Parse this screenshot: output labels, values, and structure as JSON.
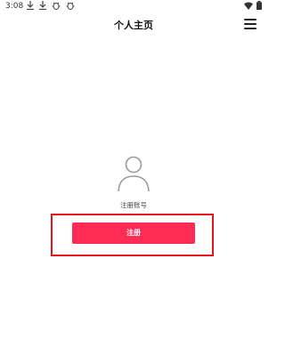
{
  "status_bar": {
    "time": "3:08",
    "notification_icons": [
      "download-icon",
      "download-icon",
      "bug-icon",
      "bug-icon"
    ],
    "right_icons": [
      "wifi-icon",
      "battery-icon"
    ]
  },
  "header": {
    "title": "个人主页",
    "menu_icon": "menu-icon"
  },
  "profile": {
    "avatar_icon": "user-avatar-icon",
    "register_account_label": "注册账号",
    "register_button_label": "注册"
  },
  "colors": {
    "accent": "#fe2c55",
    "highlight_border": "#e8141c"
  }
}
